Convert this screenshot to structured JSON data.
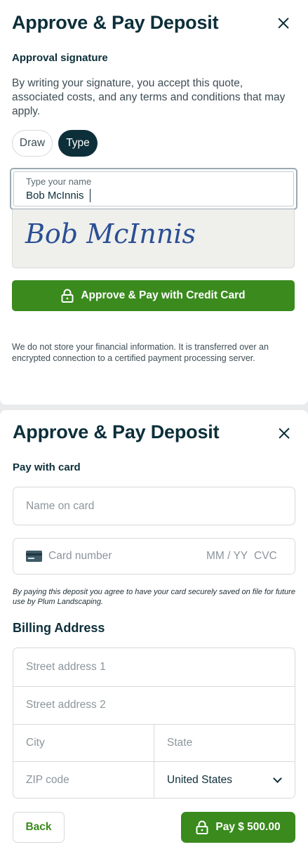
{
  "signature_panel": {
    "title": "Approve & Pay Deposit",
    "section_heading": "Approval signature",
    "instructions": "By writing your signature, you accept this quote, associated costs, and any terms and conditions that may apply.",
    "mode_tabs": [
      {
        "label": "Draw",
        "selected": false
      },
      {
        "label": "Type",
        "selected": true
      }
    ],
    "name_field": {
      "label": "Type your name",
      "value": "Bob McInnis"
    },
    "signature_preview": "Bob McInnis",
    "approve_button_label": "Approve & Pay with Credit Card",
    "security_note": "We do not store your financial information. It is transferred over an encrypted connection to a certified payment processing server."
  },
  "payment_panel": {
    "title": "Approve & Pay Deposit",
    "section_heading": "Pay with card",
    "name_on_card_placeholder": "Name on card",
    "card_number_placeholder": "Card number",
    "expiry_placeholder": "MM / YY",
    "cvc_placeholder": "CVC",
    "consent_note": "By paying this deposit you agree to have your card securely saved on file for future use by Plum Landscaping.",
    "billing_heading": "Billing Address",
    "address": {
      "street1_placeholder": "Street address 1",
      "street2_placeholder": "Street address 2",
      "city_placeholder": "City",
      "state_placeholder": "State",
      "zip_placeholder": "ZIP code",
      "country_value": "United States"
    },
    "back_label": "Back",
    "pay_label": "Pay $ 500.00"
  },
  "colors": {
    "primary_green": "#3a8a1e",
    "dark_navy": "#0c2f3a",
    "signature_ink": "#2a4f93"
  },
  "icons": [
    "close-icon",
    "lock-icon",
    "credit-card-icon",
    "chevron-down-icon"
  ]
}
